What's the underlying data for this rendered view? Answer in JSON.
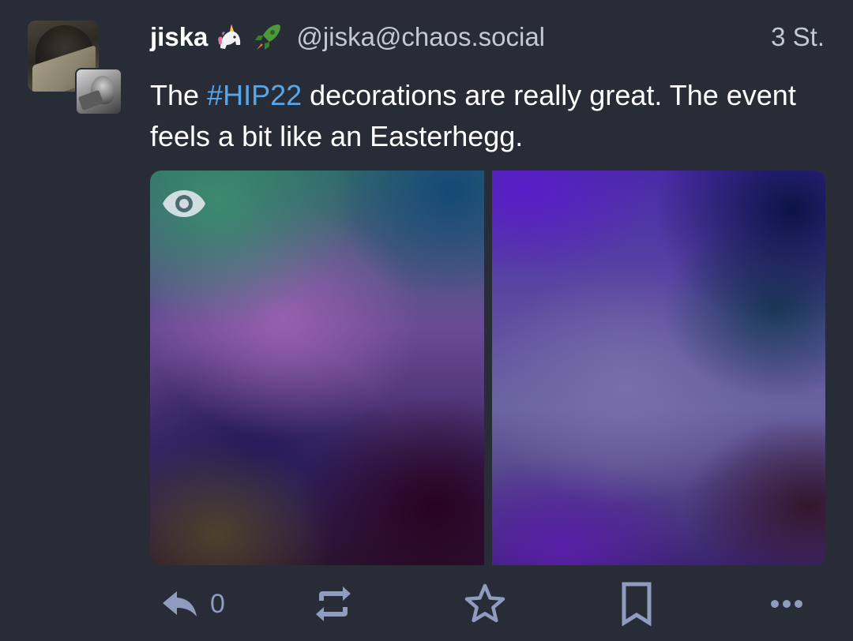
{
  "status": {
    "author": {
      "display_name": "jiska",
      "emojis": [
        "unicorn-emoji",
        "rocket-emoji"
      ],
      "acct": "@jiska@chaos.social"
    },
    "timestamp": "3 St.",
    "content": {
      "part1": "The ",
      "hashtag": "#HIP22",
      "part2": " decorations are really great. The event feels a bit like an Easterhegg."
    },
    "media": {
      "count": 2,
      "sensitive_hidden": true,
      "toggle_icon": "eye-icon"
    },
    "actions": {
      "reply_count": "0",
      "icons": [
        "reply-icon",
        "boost-icon",
        "star-icon",
        "bookmark-icon",
        "more-icon"
      ]
    }
  },
  "colors": {
    "background": "#282c37",
    "text_primary": "#ffffff",
    "text_secondary": "#c3c8d6",
    "hashtag": "#58a6e8",
    "action_icon": "#8f9bbf"
  }
}
